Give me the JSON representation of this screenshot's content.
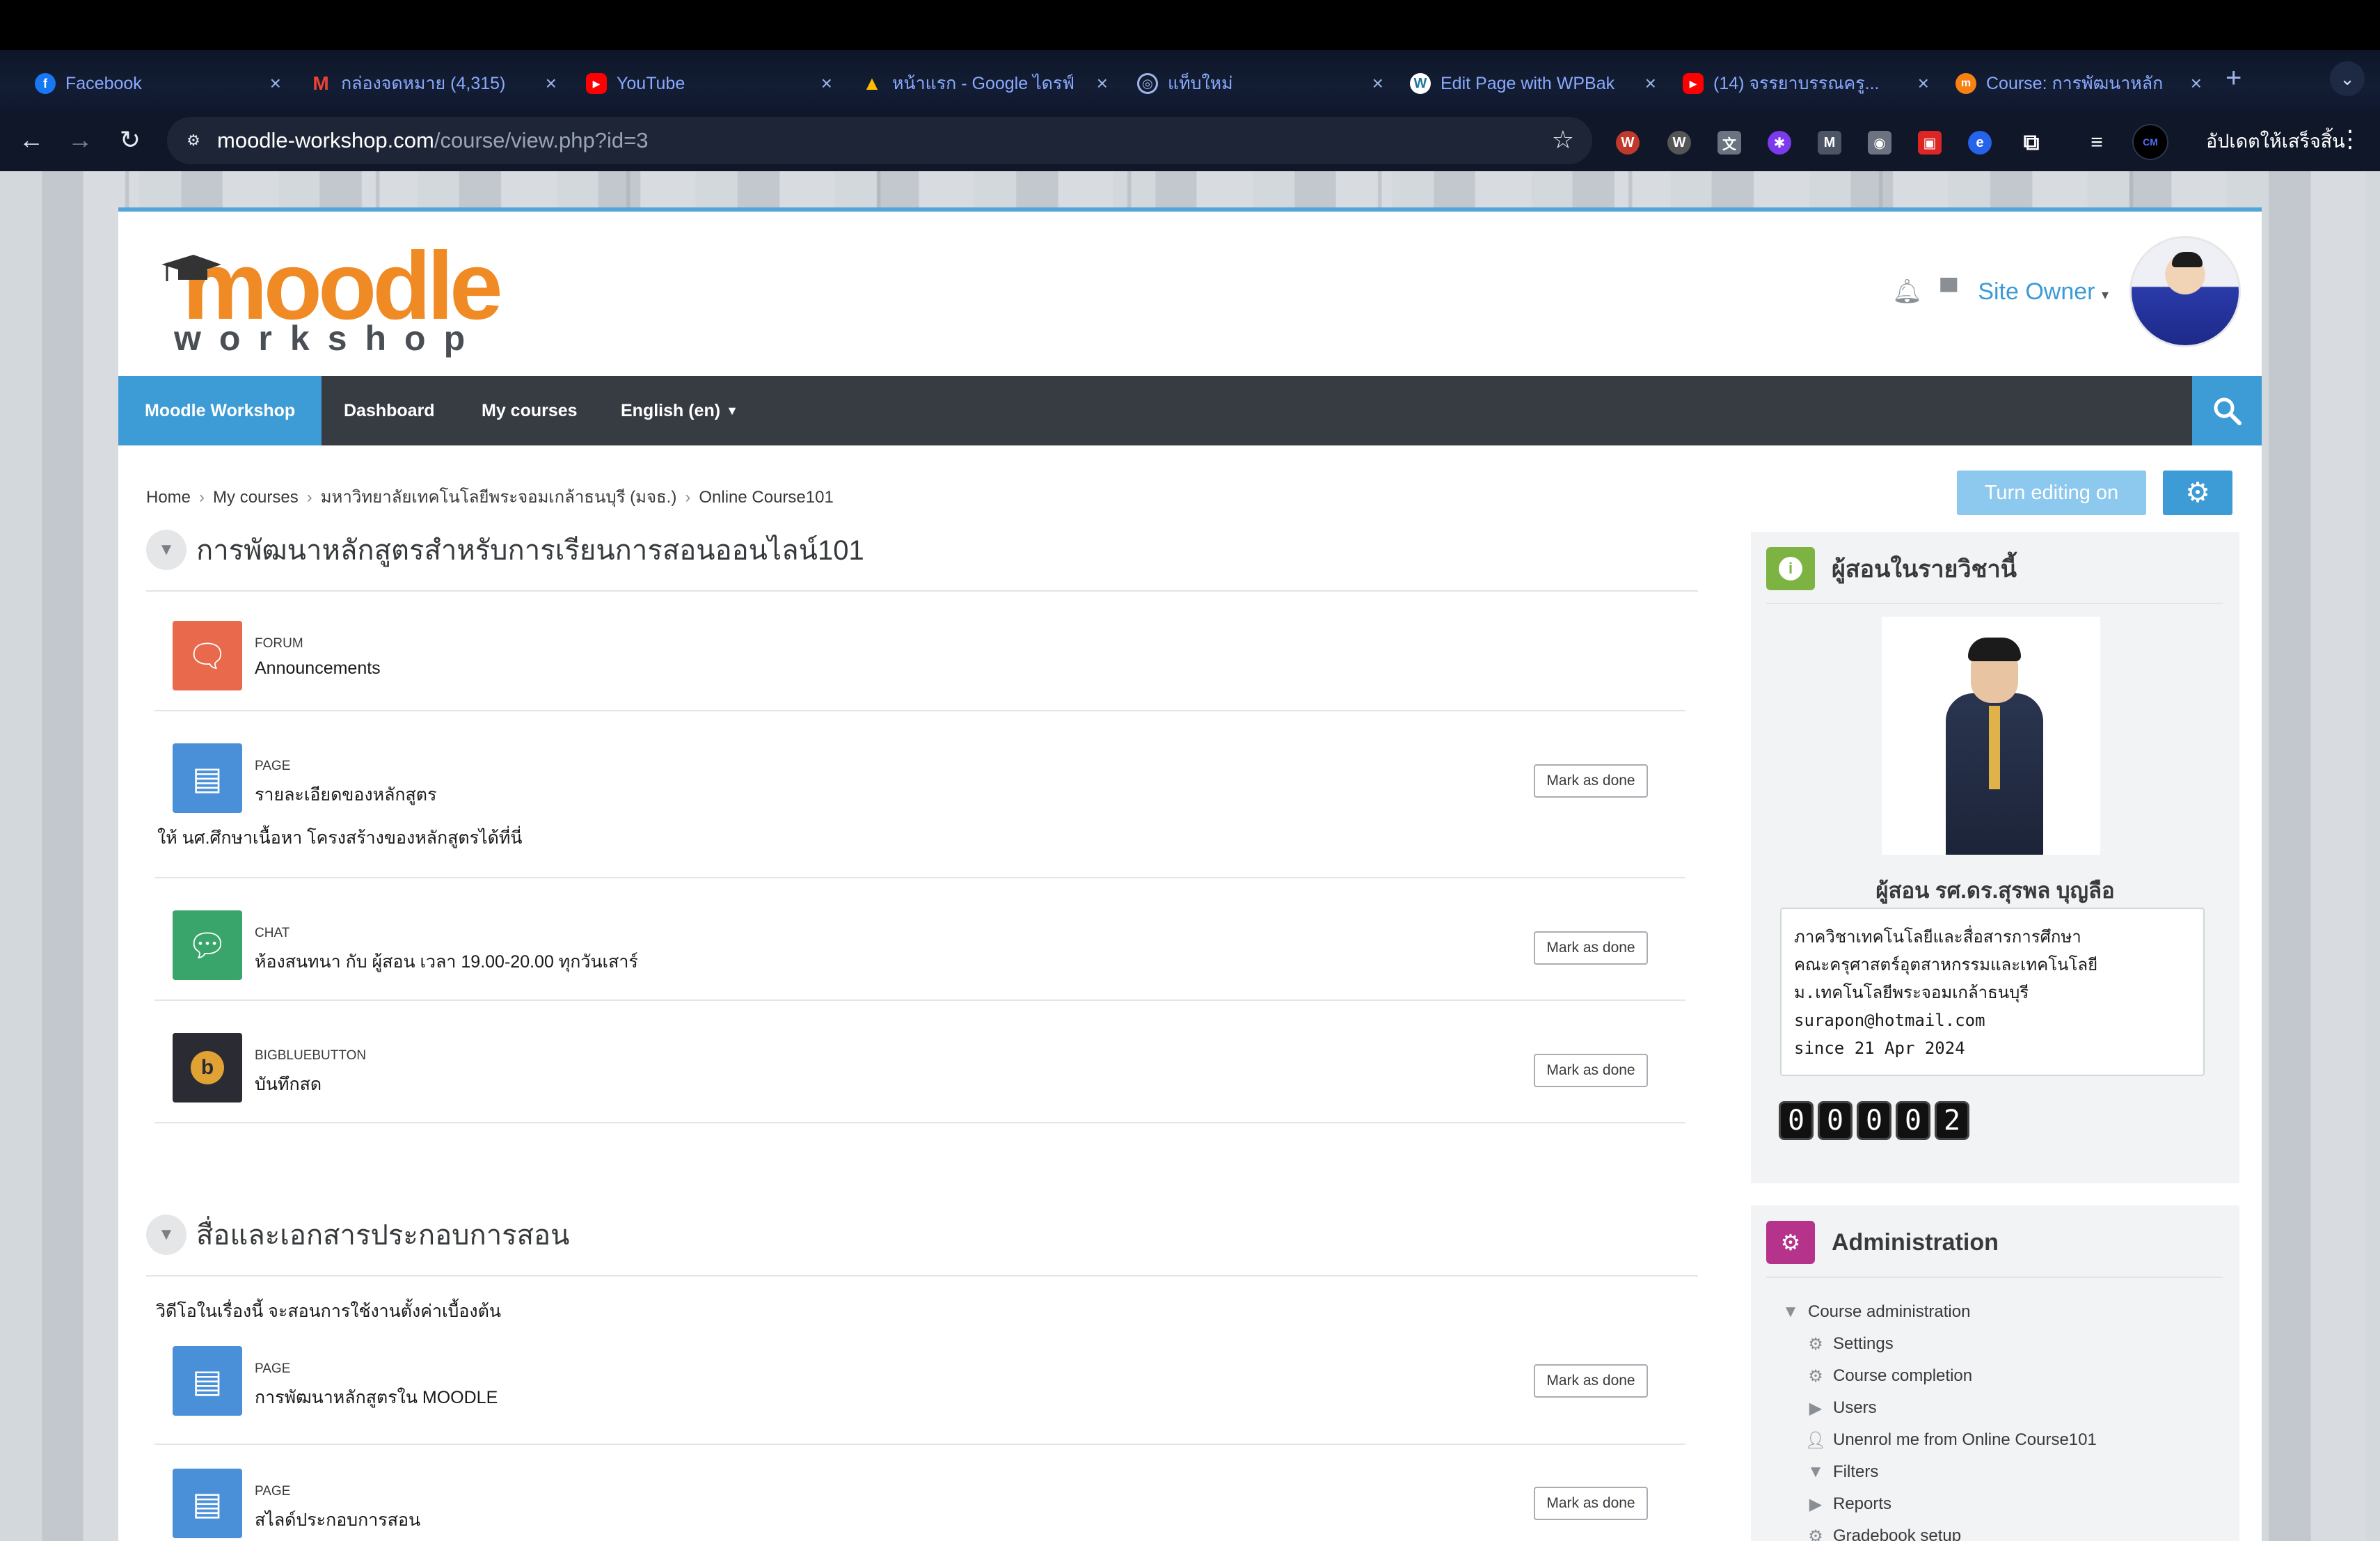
{
  "browser": {
    "tabs": [
      {
        "title": "Facebook",
        "icon": "facebook-icon",
        "color": "#1877f2"
      },
      {
        "title": "กล่องจดหมาย (4,315)",
        "icon": "gmail-icon",
        "color": "#ea4335"
      },
      {
        "title": "YouTube",
        "icon": "youtube-icon",
        "color": "#ff0000"
      },
      {
        "title": "หน้าแรก - Google ไดรฟ์",
        "icon": "google-drive-icon",
        "color": "#fbbc04"
      },
      {
        "title": "แท็บใหม่",
        "icon": "globe-icon",
        "color": "#5f6368"
      },
      {
        "title": "Edit Page with WPBak",
        "icon": "wordpress-icon",
        "color": "#21759b"
      },
      {
        "title": "(14) จรรยาบรรณครู...",
        "icon": "youtube-icon",
        "color": "#ff0000"
      },
      {
        "title": "Course: การพัฒนาหลัก",
        "icon": "moodle-icon",
        "color": "#f98012"
      }
    ],
    "url_host": "moodle-workshop.com",
    "url_path": "/course/view.php?id=3",
    "update_label": "อัปเดตให้เสร็จสิ้น"
  },
  "header": {
    "logo_main": "moodle",
    "logo_sub": "workshop",
    "user_name": "Site Owner"
  },
  "nav": {
    "site": "Moodle Workshop",
    "dashboard": "Dashboard",
    "my_courses": "My courses",
    "language": "English (en)"
  },
  "breadcrumb": [
    "Home",
    "My courses",
    "มหาวิทยาลัยเทคโนโลยีพระจอมเกล้าธนบุรี (มจธ.)",
    "Online Course101"
  ],
  "buttons": {
    "turn_editing": "Turn editing on",
    "mark_done": "Mark as done"
  },
  "sections": [
    {
      "title": "การพัฒนาหลักสูตรสำหรับการเรียนการสอนออนไลน์101",
      "activities": [
        {
          "type": "FORUM",
          "name": "Announcements",
          "color": "#e8694c",
          "icon": "forum-icon"
        },
        {
          "type": "PAGE",
          "name": "รายละเอียดของหลักสูตร",
          "color": "#4a90d9",
          "icon": "page-icon",
          "desc": "ให้ นศ.ศึกษาเนื้อหา โครงสร้างของหลักสูตรได้ที่นี่"
        },
        {
          "type": "CHAT",
          "name": "ห้องสนทนา กับ ผู้สอน เวลา 19.00-20.00 ทุกวันเสาร์",
          "color": "#3aa56b",
          "icon": "chat-icon"
        },
        {
          "type": "BIGBLUEBUTTON",
          "name": "บันทึกสด",
          "color": "#2b2b33",
          "icon": "bigbluebutton-icon"
        }
      ]
    },
    {
      "title": "สื่อและเอกสารประกอบการสอน",
      "summary": "วิดีโอในเรื่องนี้ จะสอนการใช้งานตั้งค่าเบื้องต้น",
      "activities": [
        {
          "type": "PAGE",
          "name": "การพัฒนาหลักสูตรใน MOODLE",
          "color": "#4a90d9",
          "icon": "page-icon"
        },
        {
          "type": "PAGE",
          "name": "สไลด์ประกอบการสอน",
          "color": "#4a90d9",
          "icon": "page-icon"
        }
      ]
    }
  ],
  "teacher_block": {
    "title": "ผู้สอนในรายวิชานี้",
    "name": "ผู้สอน รศ.ดร.สุรพล บุญลือ",
    "info": "ภาควิชาเทคโนโลยีและสื่อสารการศึกษา\nคณะครุศาสตร์อุตสาหกรรมและเทคโนโลยี\nม.เทคโนโลยีพระจอมเกล้าธนบุรี\nsurapon@hotmail.com\nsince 21 Apr 2024",
    "counter": [
      "0",
      "0",
      "0",
      "0",
      "2"
    ]
  },
  "admin_block": {
    "title": "Administration",
    "items": [
      {
        "label": "Course administration",
        "icon": "caret-down-icon",
        "level": 1
      },
      {
        "label": "Settings",
        "icon": "gear-icon",
        "level": 2
      },
      {
        "label": "Course completion",
        "icon": "gear-icon",
        "level": 2
      },
      {
        "label": "Users",
        "icon": "caret-right-icon",
        "level": 2
      },
      {
        "label": "Unenrol me from Online Course101",
        "icon": "user-icon",
        "level": 2
      },
      {
        "label": "Filters",
        "icon": "filter-icon",
        "level": 2
      },
      {
        "label": "Reports",
        "icon": "caret-right-icon",
        "level": 2
      },
      {
        "label": "Gradebook setup",
        "icon": "gear-icon",
        "level": 2
      }
    ]
  },
  "colors": {
    "brand_blue": "#3d9bd6",
    "nav_dark": "#373c42",
    "logo_orange": "#f08a24"
  }
}
